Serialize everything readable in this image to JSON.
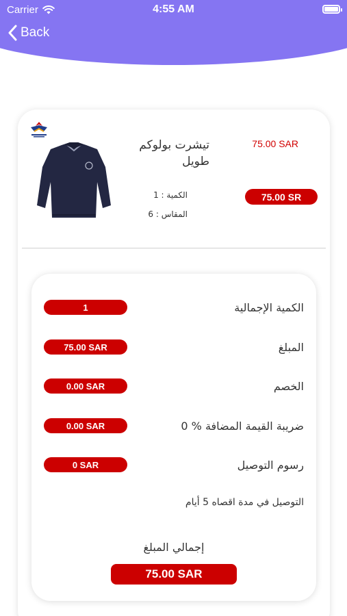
{
  "status_bar": {
    "carrier": "Carrier",
    "time": "4:55 AM"
  },
  "nav": {
    "back_label": "Back"
  },
  "colors": {
    "header": "#8575f2",
    "accent": "#cc0000",
    "price_text": "#d10000"
  },
  "product": {
    "brand_icon": "first-fashion-logo",
    "image": "navy-long-sleeve-polo-shirt",
    "name": "تيشرت بولوكم طويل",
    "price": "75.00 SAR",
    "price_pill": "75.00 SR",
    "quantity": "الكمية : 1",
    "size": "المقاس : 6"
  },
  "summary": {
    "rows": [
      {
        "label": "الكمية الإجمالية",
        "value": "1"
      },
      {
        "label": "المبلغ",
        "value": "75.00 SAR"
      },
      {
        "label": "الخصم",
        "value": "0.00 SAR"
      },
      {
        "label": "ضريبة القيمة المضافة % 0",
        "value": "0.00 SAR"
      },
      {
        "label": "رسوم التوصيل",
        "value": "0 SAR"
      }
    ],
    "delivery_note": "التوصيل في مدة اقصاه 5 أيام",
    "total_label": "إجمالي المبلغ",
    "total_value": "75.00 SAR"
  }
}
